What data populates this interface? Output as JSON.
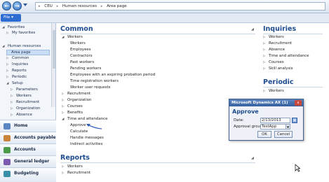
{
  "titlebar": {
    "back": "←",
    "forward": "→",
    "breadcrumb": [
      "CEU",
      "Human resources",
      "Area page"
    ]
  },
  "file_button": "File ▾",
  "nav": {
    "favorites_header": "Favorites",
    "favorites_items": [
      "My favorites"
    ],
    "module_header": "Human resources",
    "module_items": [
      "Area page",
      "Common",
      "Inquiries",
      "Reports",
      "Periodic",
      "Setup"
    ],
    "setup_items": [
      "Parameters",
      "Workers",
      "Recruitment",
      "Organization",
      "Absence"
    ],
    "pane_buttons": [
      "Home",
      "Accounts payable",
      "Accounts receiva...",
      "General ledger",
      "Budgeting"
    ]
  },
  "common": {
    "title": "Common",
    "workers_group": "Workers",
    "workers_items": [
      "Workers",
      "Employees",
      "Contractors",
      "Past workers",
      "Pending workers",
      "Employees with an expiring probation period",
      "Time registration workers",
      "Worker user requests"
    ],
    "groups": [
      "Recruitment",
      "Organization",
      "Courses",
      "Benefits"
    ],
    "time_group": "Time and attendance",
    "time_items": [
      "Approve",
      "Calculate",
      "Handle messages",
      "Indirect activities"
    ]
  },
  "reports": {
    "title": "Reports",
    "items": [
      "Workers",
      "Recruitment"
    ]
  },
  "inquiries": {
    "title": "Inquiries",
    "items": [
      "Workers",
      "Recruitment",
      "Absence",
      "Time and attendance",
      "Courses",
      "Skill analysis"
    ]
  },
  "periodic": {
    "title": "Periodic",
    "items": [
      "Workers"
    ]
  },
  "dialog": {
    "title": "Microsoft Dynamics AX (1)",
    "close": "x",
    "heading": "Approve",
    "date_label": "Date:",
    "date_value": "2/13/2013",
    "group_label": "Approval group:",
    "group_value": "TestApp",
    "ok": "OK",
    "cancel": "Cancel"
  },
  "colors": {
    "accent": "#1d4b8e",
    "dialog_title": "#35609f"
  }
}
